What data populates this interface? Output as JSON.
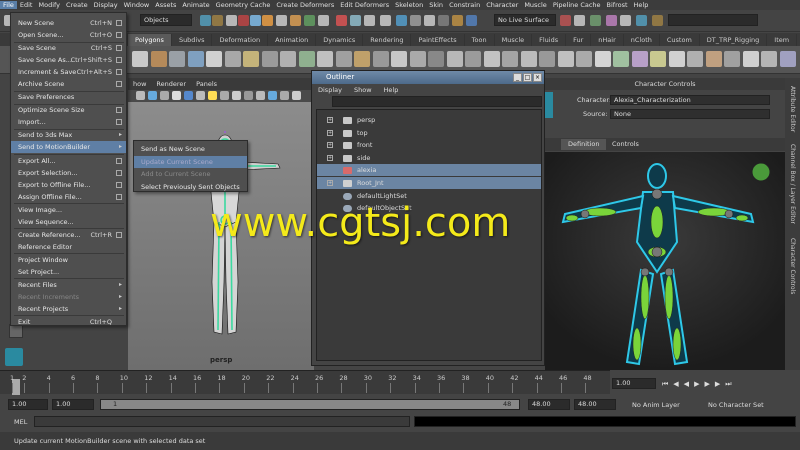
{
  "menubar": [
    "File",
    "Edit",
    "Modify",
    "Create",
    "Display",
    "Window",
    "Assets",
    "Animate",
    "Geometry Cache",
    "Create Deformers",
    "Edit Deformers",
    "Skeleton",
    "Skin",
    "Constrain",
    "Character",
    "Muscle",
    "Pipeline Cache",
    "Bifrost",
    "Help"
  ],
  "status": {
    "objects_label": "Objects",
    "live_surface": "No Live Surface"
  },
  "shelf_tabs": [
    "Polygons",
    "Subdivs",
    "Deformation",
    "Animation",
    "Dynamics",
    "Rendering",
    "PaintEffects",
    "Toon",
    "Muscle",
    "Fluids",
    "Fur",
    "nHair",
    "nCloth",
    "Custom",
    "DT_TRP_Rigging",
    "Item"
  ],
  "shelf_tabs_active": "Polygons",
  "viewport": {
    "menu": [
      "how",
      "Renderer",
      "Panels"
    ],
    "camera_label": "persp"
  },
  "file_menu": {
    "items": [
      {
        "label": "New Scene",
        "shortcut": "Ctrl+N",
        "option": true
      },
      {
        "label": "Open Scene...",
        "shortcut": "Ctrl+O",
        "option": true
      },
      {
        "label": "Save Scene",
        "shortcut": "Ctrl+S",
        "option": true
      },
      {
        "label": "Save Scene As...",
        "shortcut": "Ctrl+Shift+S",
        "option": true
      },
      {
        "label": "Increment & Save",
        "shortcut": "Ctrl+Alt+S",
        "option": true
      },
      {
        "label": "Archive Scene",
        "option": true
      },
      {
        "label": "Save Preferences"
      },
      {
        "label": "Optimize Scene Size",
        "option": true
      },
      {
        "label": "Import...",
        "option": true
      },
      {
        "label": "Send to 3ds Max",
        "submenu": true
      },
      {
        "label": "Send to MotionBuilder",
        "submenu": true,
        "highlight": true
      },
      {
        "label": "Export All...",
        "option": true
      },
      {
        "label": "Export Selection...",
        "option": true
      },
      {
        "label": "Export to Offline File...",
        "option": true
      },
      {
        "label": "Assign Offline File...",
        "option": true
      },
      {
        "label": "View Image..."
      },
      {
        "label": "View Sequence..."
      },
      {
        "label": "Create Reference...",
        "shortcut": "Ctrl+R",
        "option": true
      },
      {
        "label": "Reference Editor"
      },
      {
        "label": "Project Window"
      },
      {
        "label": "Set Project..."
      },
      {
        "label": "Recent Files",
        "submenu": true
      },
      {
        "label": "Recent Increments",
        "disabled": true,
        "submenu": true
      },
      {
        "label": "Recent Projects",
        "submenu": true
      },
      {
        "label": "Exit",
        "shortcut": "Ctrl+Q"
      }
    ]
  },
  "submenu": {
    "items": [
      {
        "label": "Send as New Scene"
      },
      {
        "label": "Update Current Scene",
        "highlight": true
      },
      {
        "label": "Add to Current Scene",
        "disabled": true
      },
      {
        "label": "Select Previously Sent Objects"
      }
    ]
  },
  "outliner": {
    "title": "Outliner",
    "menu": [
      "Display",
      "Show",
      "Help"
    ],
    "items": [
      {
        "label": "persp",
        "type": "camera"
      },
      {
        "label": "top",
        "type": "camera"
      },
      {
        "label": "front",
        "type": "camera"
      },
      {
        "label": "side",
        "type": "camera"
      },
      {
        "label": "alexia",
        "type": "mesh",
        "selected": true
      },
      {
        "label": "Root_Jnt",
        "type": "joint",
        "selected": true
      },
      {
        "label": "defaultLightSet",
        "type": "set"
      },
      {
        "label": "defaultObjectSet",
        "type": "set"
      }
    ]
  },
  "character_controls": {
    "header": "Character Controls",
    "character_label": "Character:",
    "character_value": "Alexia_Characterization",
    "source_label": "Source:",
    "source_value": "None",
    "tabs": [
      "Definition",
      "Controls"
    ],
    "active_tab": "Definition"
  },
  "right_bar": [
    "Attribute Editor",
    "Channel Box / Layer Editor",
    "Character Controls"
  ],
  "timeline": {
    "ticks": [
      "1",
      "2",
      "4",
      "6",
      "8",
      "10",
      "12",
      "14",
      "16",
      "18",
      "20",
      "22",
      "24",
      "26",
      "28",
      "30",
      "32",
      "34",
      "36",
      "38",
      "40",
      "42",
      "44",
      "46",
      "48"
    ],
    "current_frame": "1.00"
  },
  "range": {
    "start": "1.00",
    "start2": "1.00",
    "handle": "1",
    "end_marker": "48",
    "end": "48.00",
    "end2": "48.00",
    "anim_layer": "No Anim Layer",
    "character_set": "No Character Set"
  },
  "cmdline": {
    "label": "MEL"
  },
  "help_line": "Update current MotionBuilder scene with selected data set",
  "watermark": "www.cgtsj.com",
  "colors": {
    "menu_highlight": "#5f7fa5",
    "outliner_selection": "#6b85a3",
    "watermark": "#f4ea1a",
    "hik_green": "#7ad43a",
    "hik_cyan": "#2ec8e8"
  }
}
